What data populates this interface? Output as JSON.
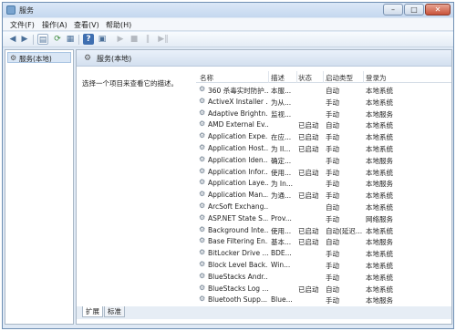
{
  "window": {
    "title": "服务",
    "controls": {
      "minimize": "–",
      "maximize": "□",
      "close": "✕"
    }
  },
  "menu": [
    {
      "label": "文件(F)"
    },
    {
      "label": "操作(A)"
    },
    {
      "label": "查看(V)"
    },
    {
      "label": "帮助(H)"
    }
  ],
  "toolbar_icons": [
    {
      "name": "back-arrow-icon",
      "glyph": "◀"
    },
    {
      "name": "forward-arrow-icon",
      "glyph": "▶"
    },
    {
      "name": "console-tree-icon",
      "glyph": "▤"
    },
    {
      "name": "refresh-icon",
      "glyph": "⟳"
    },
    {
      "name": "export-list-icon",
      "glyph": "▦"
    },
    {
      "name": "help-icon",
      "glyph": "?"
    },
    {
      "name": "properties-icon",
      "glyph": "▣"
    },
    {
      "name": "start-service-icon",
      "glyph": "▶"
    },
    {
      "name": "stop-service-icon",
      "glyph": "■"
    },
    {
      "name": "pause-service-icon",
      "glyph": "‖"
    },
    {
      "name": "restart-service-icon",
      "glyph": "▶‖"
    }
  ],
  "tree": {
    "node_label": "服务(本地)"
  },
  "main": {
    "header": "服务(本地)",
    "description_prompt": "选择一个项目来查看它的描述。"
  },
  "columns": {
    "name": "名称",
    "description": "描述",
    "status": "状态",
    "startup": "启动类型",
    "logon": "登录为"
  },
  "services": [
    {
      "name": "360 杀毒实时防护...",
      "desc": "本服...",
      "status": "",
      "startup": "自动",
      "logon": "本地系统"
    },
    {
      "name": "ActiveX Installer ...",
      "desc": "为从...",
      "status": "",
      "startup": "手动",
      "logon": "本地系统"
    },
    {
      "name": "Adaptive Brightn...",
      "desc": "监视...",
      "status": "",
      "startup": "手动",
      "logon": "本地服务"
    },
    {
      "name": "AMD External Ev...",
      "desc": "",
      "status": "已启动",
      "startup": "自动",
      "logon": "本地系统"
    },
    {
      "name": "Application Expe...",
      "desc": "在应...",
      "status": "已启动",
      "startup": "手动",
      "logon": "本地系统"
    },
    {
      "name": "Application Host...",
      "desc": "为 II...",
      "status": "已启动",
      "startup": "手动",
      "logon": "本地系统"
    },
    {
      "name": "Application Iden...",
      "desc": "确定...",
      "status": "",
      "startup": "手动",
      "logon": "本地服务"
    },
    {
      "name": "Application Infor...",
      "desc": "使用...",
      "status": "已启动",
      "startup": "手动",
      "logon": "本地系统"
    },
    {
      "name": "Application Laye...",
      "desc": "为 In...",
      "status": "",
      "startup": "手动",
      "logon": "本地服务"
    },
    {
      "name": "Application Man...",
      "desc": "为通...",
      "status": "已启动",
      "startup": "手动",
      "logon": "本地系统"
    },
    {
      "name": "ArcSoft Exchang...",
      "desc": "",
      "status": "",
      "startup": "自动",
      "logon": "本地系统"
    },
    {
      "name": "ASP.NET State S...",
      "desc": "Prov...",
      "status": "",
      "startup": "手动",
      "logon": "网络服务"
    },
    {
      "name": "Background Inte...",
      "desc": "使用...",
      "status": "已启动",
      "startup": "自动(延迟...",
      "logon": "本地系统"
    },
    {
      "name": "Base Filtering En...",
      "desc": "基本...",
      "status": "已启动",
      "startup": "自动",
      "logon": "本地服务"
    },
    {
      "name": "BitLocker Drive ...",
      "desc": "BDE...",
      "status": "",
      "startup": "手动",
      "logon": "本地系统"
    },
    {
      "name": "Block Level Back...",
      "desc": "Win...",
      "status": "",
      "startup": "手动",
      "logon": "本地系统"
    },
    {
      "name": "BlueStacks Andr...",
      "desc": "",
      "status": "",
      "startup": "手动",
      "logon": "本地系统"
    },
    {
      "name": "BlueStacks Log ...",
      "desc": "",
      "status": "已启动",
      "startup": "自动",
      "logon": "本地系统"
    },
    {
      "name": "Bluetooth Supp...",
      "desc": "Blue...",
      "status": "",
      "startup": "手动",
      "logon": "本地服务"
    }
  ],
  "tabs": [
    {
      "label": "扩展"
    },
    {
      "label": "标准"
    }
  ]
}
